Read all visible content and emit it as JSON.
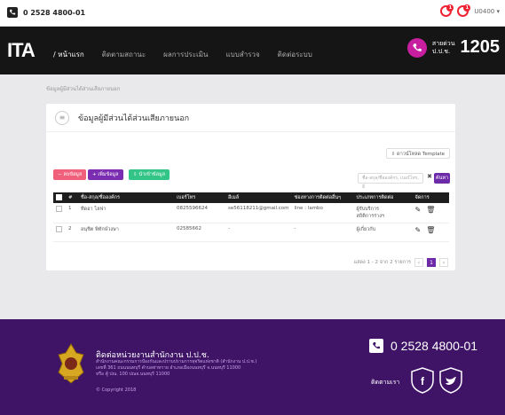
{
  "topbar": {
    "phone": "0 2528 4800-01",
    "badge1": "1",
    "badge2": "1",
    "user": "U0400 ▾"
  },
  "nav": {
    "logo": "ITA",
    "items": [
      "/ หน้าแรก",
      "ติดตามสถานะ",
      "ผลการประเมิน",
      "แบบสำรวจ",
      "ติดต่อระบบ"
    ],
    "hotline_label1": "สายด่วน",
    "hotline_label2": "ป.ป.ช.",
    "hotline_number": "1205"
  },
  "breadcrumb": "ข้อมูลผู้มีส่วนได้ส่วนเสียภายนอก",
  "card": {
    "title": "ข้อมูลผู้มีส่วนได้ส่วนเสียภายนอก"
  },
  "buttons": {
    "delete": "− ลบข้อมูล",
    "add": "+ เพิ่มข้อมูล",
    "import": "⇩ นำเข้าข้อมูล",
    "template": "⇩ ดาวน์โหลด Template",
    "search": "ค้นหา"
  },
  "search": {
    "placeholder": "ชื่อ-สกุล/ชื่อองค์กร, เบอร์โทร, อี"
  },
  "table": {
    "headers": [
      "",
      "#",
      "ชื่อ-สกุล/ชื่อองค์กร",
      "เบอร์โทร",
      "อีเมล์",
      "ช่องทางการติดต่ออื่นๆ",
      "ประเภทการติดต่อ",
      "จัดการ"
    ],
    "rows": [
      {
        "no": "1",
        "name": "ทีดอา ไลฟา",
        "phone": "0825596624",
        "email": "se56118211@gmail.com",
        "other": "line : lambo",
        "type1": "ผู้รับบริการ",
        "type2": "สถิติการร่างฯ"
      },
      {
        "no": "2",
        "name": "อนุชิต พิทักษ์วงษา",
        "phone": "02585662",
        "email": "-",
        "other": "-",
        "type1": "ผู้เกี่ยวกับ",
        "type2": ""
      }
    ]
  },
  "pager": {
    "summary": "แสดง 1 - 2 จาก 2 รายการ",
    "prev": "‹",
    "page": "1",
    "next": "›"
  },
  "footer": {
    "title": "ติดต่อหน่วยงานสำนักงาน ป.ป.ช.",
    "addr1": "สำนักงานคณะกรรมการป้องกันและปราบปรามการทุจริตแห่งชาติ (สำนักงาน ป.ป.ช.)",
    "addr2": "เลขที่ 361 ถนนนนทบุรี ตำบลท่าทราย อำเภอเมืองนนทบุรี จ.นนทบุรี 11000",
    "addr3": "หรือ ตู้ ปณ. 100 ปณจ.นนทบุรี 11000",
    "copyright": "© Copyright 2018",
    "phone": "0 2528 4800-01",
    "follow": "ติดตามเรา"
  }
}
